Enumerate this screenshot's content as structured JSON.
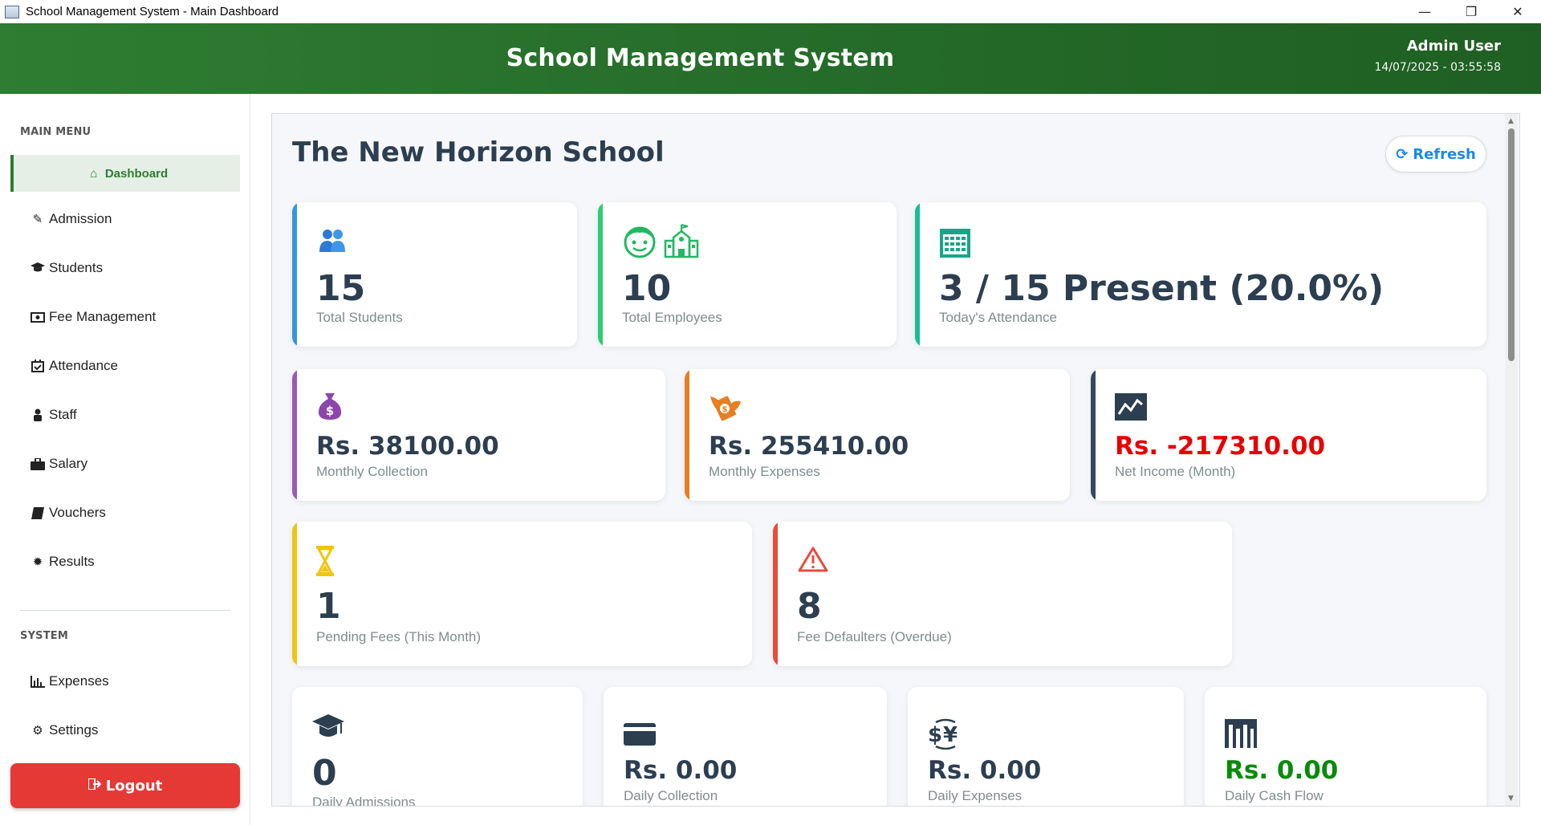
{
  "window": {
    "title": "School Management System - Main Dashboard"
  },
  "header": {
    "app_title": "School Management System",
    "user_name": "Admin User",
    "datetime": "14/07/2025 - 03:55:58"
  },
  "sidebar": {
    "main_menu_label": "MAIN MENU",
    "system_label": "SYSTEM",
    "items": [
      {
        "label": "Dashboard",
        "icon": "home-icon"
      },
      {
        "label": "Admission",
        "icon": "edit-icon"
      },
      {
        "label": "Students",
        "icon": "graduation-cap-icon"
      },
      {
        "label": "Fee Management",
        "icon": "money-icon"
      },
      {
        "label": "Attendance",
        "icon": "calendar-check-icon"
      },
      {
        "label": "Staff",
        "icon": "user-icon"
      },
      {
        "label": "Salary",
        "icon": "briefcase-icon"
      },
      {
        "label": "Vouchers",
        "icon": "book-icon"
      },
      {
        "label": "Results",
        "icon": "certificate-icon"
      }
    ],
    "system_items": [
      {
        "label": "Expenses",
        "icon": "bar-chart-icon"
      },
      {
        "label": "Settings",
        "icon": "gear-icon"
      }
    ],
    "logout_label": "Logout"
  },
  "main": {
    "school_name": "The New Horizon School",
    "refresh_label": "Refresh",
    "cards": [
      {
        "value": "15",
        "label": "Total Students",
        "accent": "#3498db"
      },
      {
        "value": "10",
        "label": "Total Employees",
        "accent": "#2ecc71"
      },
      {
        "value": "3 / 15 Present (20.0%)",
        "label": "Today's Attendance",
        "accent": "#1abc9c"
      },
      {
        "value": "Rs. 38100.00",
        "label": "Monthly Collection",
        "accent": "#9b59b6"
      },
      {
        "value": "Rs. 255410.00",
        "label": "Monthly Expenses",
        "accent": "#e67e22"
      },
      {
        "value": "Rs. -217310.00",
        "label": "Net Income (Month)",
        "accent": "#34495e",
        "value_color": "#e60000"
      },
      {
        "value": "1",
        "label": "Pending Fees (This Month)",
        "accent": "#f1c40f"
      },
      {
        "value": "8",
        "label": "Fee Defaulters (Overdue)",
        "accent": "#e74c3c"
      },
      {
        "value": "0",
        "label": "Daily Admissions"
      },
      {
        "value": "Rs. 0.00",
        "label": "Daily Collection"
      },
      {
        "value": "Rs. 0.00",
        "label": "Daily Expenses"
      },
      {
        "value": "Rs. 0.00",
        "label": "Daily Cash Flow",
        "value_color": "#0a8a0a"
      }
    ]
  }
}
